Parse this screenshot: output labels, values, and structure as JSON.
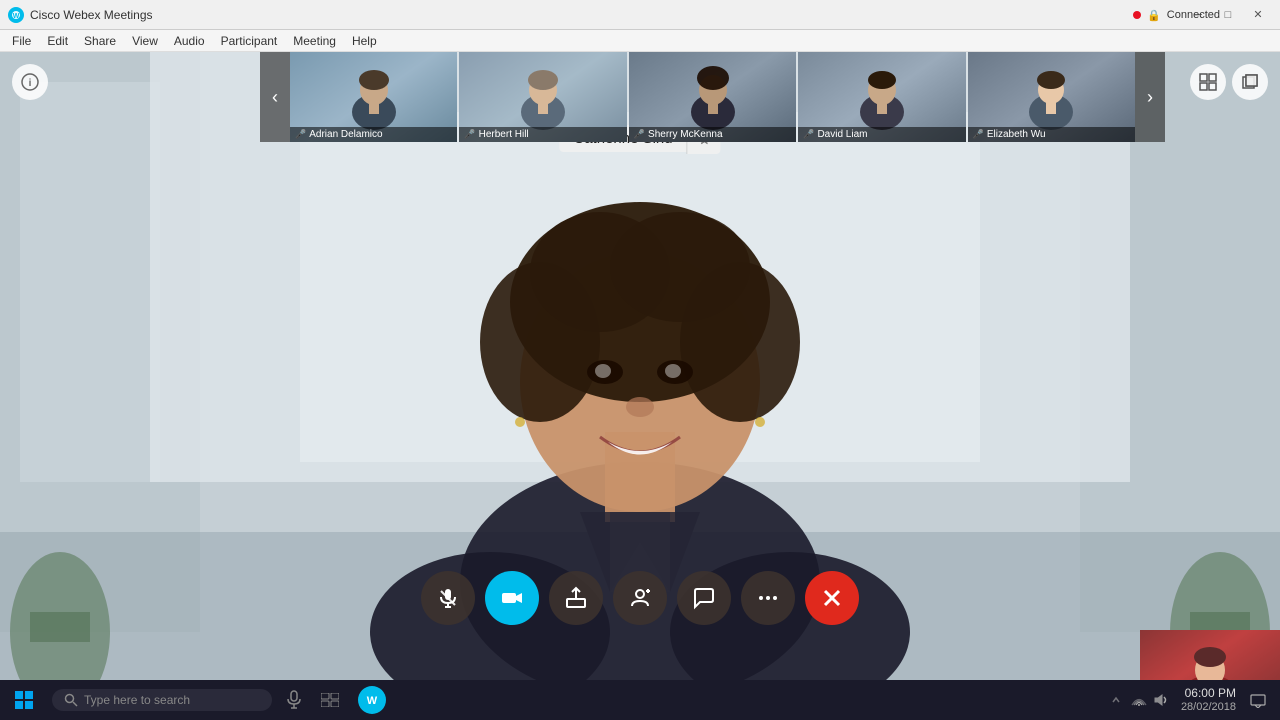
{
  "app": {
    "title": "Cisco Webex Meetings",
    "icon": "webex-logo"
  },
  "title_bar": {
    "title": "Cisco Webex Meetings",
    "minimize_label": "─",
    "maximize_label": "□",
    "close_label": "✕"
  },
  "menu_bar": {
    "items": [
      "File",
      "Edit",
      "Share",
      "View",
      "Audio",
      "Participant",
      "Meeting",
      "Help"
    ]
  },
  "connection": {
    "status": "Connected",
    "dot_color": "#e81123"
  },
  "speaker": {
    "name": "Catherine Sinu",
    "pin_icon": "✦"
  },
  "controls": {
    "info_icon": "ℹ",
    "grid_icon": "⊞",
    "popout_icon": "⧉",
    "mic_icon": "🎤",
    "camera_icon": "📷",
    "share_icon": "⬆",
    "participants_icon": "👤",
    "chat_icon": "💬",
    "more_icon": "•••",
    "end_icon": "✕"
  },
  "thumbnails": [
    {
      "name": "Adrian Delamico",
      "muted": false,
      "mic_icon": "🎤"
    },
    {
      "name": "Herbert Hill",
      "muted": true,
      "mic_icon": "🎤"
    },
    {
      "name": "Sherry McKenna",
      "muted": false,
      "mic_icon": "🎤"
    },
    {
      "name": "David Liam",
      "muted": false,
      "mic_icon": "🎤"
    },
    {
      "name": "Elizabeth Wu",
      "muted": false,
      "mic_icon": "🎤"
    }
  ],
  "nav": {
    "prev_icon": "‹",
    "next_icon": "›"
  },
  "taskbar": {
    "search_placeholder": "Type here to search",
    "time": "06:00 PM",
    "date": "28/02/2018"
  }
}
